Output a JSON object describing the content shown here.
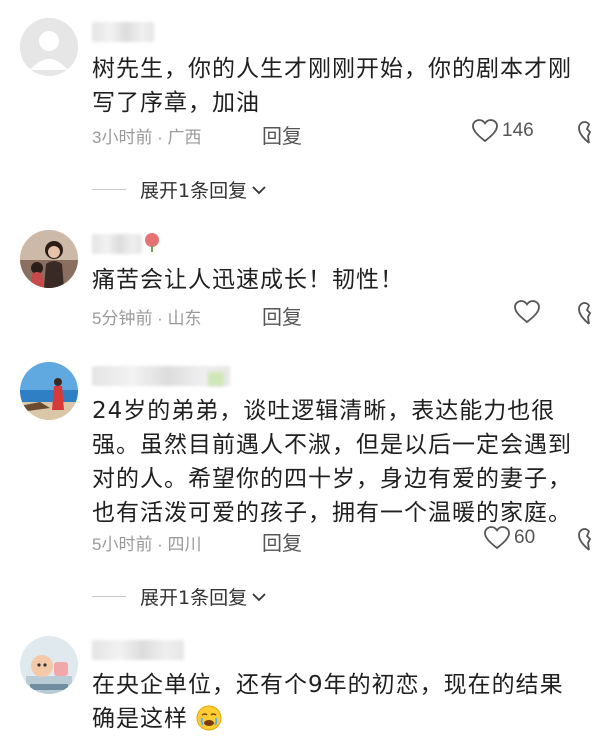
{
  "comments": [
    {
      "text_line1": "树先生，你的人生才刚刚开始，你的剧本才刚",
      "text_line2": "写了序章，加油",
      "time": "3小时前 · 广西",
      "reply_label": "回复",
      "likes": "146",
      "expand_label": "展开1条回复"
    },
    {
      "text_line1": "痛苦会让人迅速成长！韧性！",
      "time": "5分钟前 · 山东",
      "reply_label": "回复"
    },
    {
      "text_line1": "24岁的弟弟，谈吐逻辑清晰，表达能力也很",
      "text_line2": "强。虽然目前遇人不淑，但是以后一定会遇到",
      "text_line3": "对的人。希望你的四十岁，身边有爱的妻子，",
      "text_line4": "也有活泼可爱的孩子，拥有一个温暖的家庭。",
      "time": "5小时前 · 四川",
      "reply_label": "回复",
      "likes": "60",
      "expand_label": "展开1条回复"
    },
    {
      "text_line1": "在央企单位，还有个9年的初恋，现在的结果",
      "text_line2": "确是这样"
    }
  ],
  "icons": {
    "like": "heart-outline-icon",
    "dislike": "broken-heart-icon",
    "expand": "chevron-down-icon"
  },
  "colors": {
    "text": "#1f1f1f",
    "meta": "#9a9a9a",
    "reply": "#555555"
  }
}
